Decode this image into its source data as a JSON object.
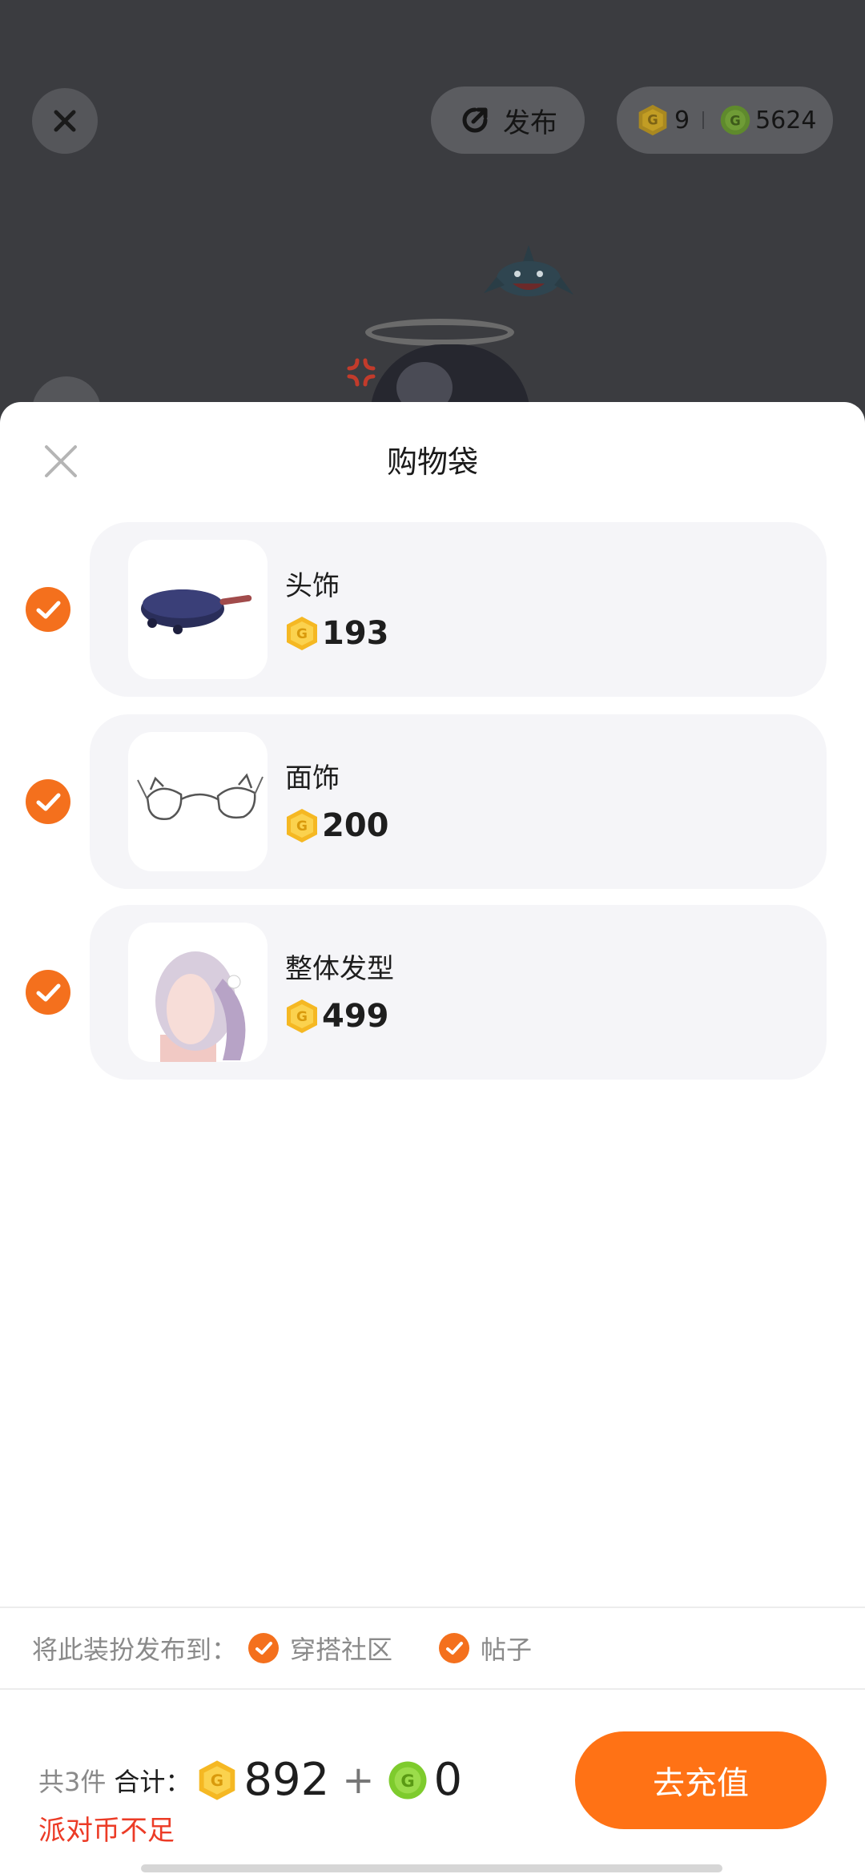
{
  "topbar": {
    "publish_label": "发布",
    "gold_balance": "9",
    "green_balance": "5624"
  },
  "sheet": {
    "title": "购物袋",
    "items": [
      {
        "name": "头饰",
        "price": "193",
        "checked": true,
        "icon": "wok-pan-icon"
      },
      {
        "name": "面饰",
        "price": "200",
        "checked": true,
        "icon": "cat-ear-glasses-icon"
      },
      {
        "name": "整体发型",
        "price": "499",
        "checked": true,
        "icon": "ponytail-hair-icon"
      }
    ]
  },
  "publish_to": {
    "label": "将此装扮发布到：",
    "options": [
      {
        "label": "穿搭社区",
        "checked": true
      },
      {
        "label": "帖子",
        "checked": true
      }
    ]
  },
  "footer": {
    "count_text": "共3件",
    "total_label": "合计：",
    "gold_total": "892",
    "plus": "+",
    "green_total": "0",
    "warning": "派对币不足",
    "recharge_label": "去充值"
  },
  "colors": {
    "accent_orange": "#ff7215",
    "check_orange": "#f4701d",
    "warning_red": "#ec3b26",
    "gold_coin": "#f5b823",
    "green_coin": "#7ecb2d",
    "card_bg": "#f5f5f8"
  }
}
